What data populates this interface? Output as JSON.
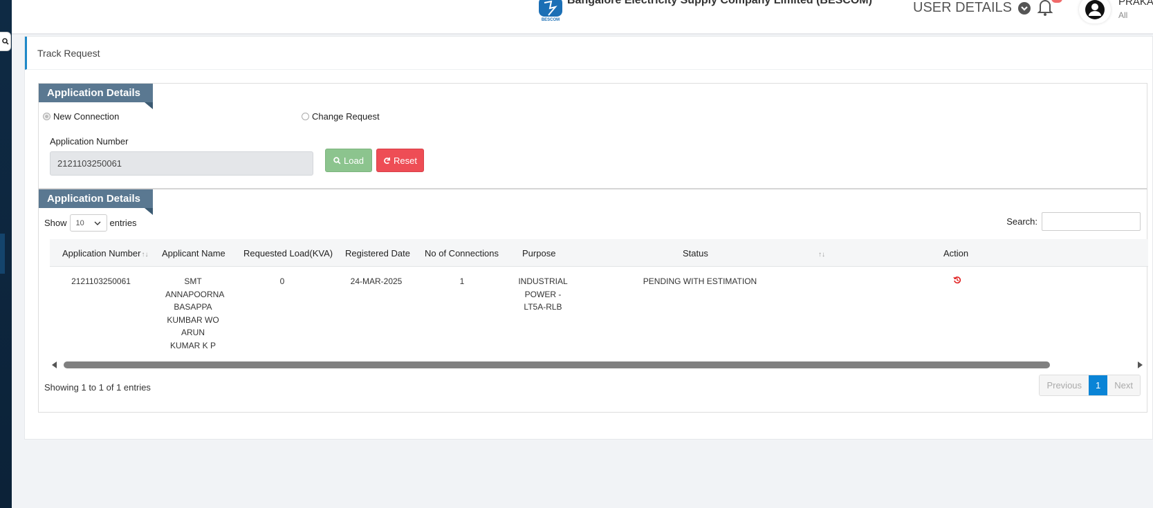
{
  "header": {
    "company_name": "Bangalore Electricity Supply Company Limited (BESCOM)",
    "logo_text": "BESCOM",
    "user_details_label": "USER DETAILS",
    "user_name": "PRAKASH",
    "user_role": "All"
  },
  "page": {
    "title": "Track Request"
  },
  "application_panel": {
    "tab_label": "Application Details",
    "radio_new": "New Connection",
    "radio_change": "Change Request",
    "selected_radio": "New Connection",
    "field_label": "Application Number",
    "field_value": "2121103250061",
    "load_label": "Load",
    "reset_label": "Reset"
  },
  "results_panel": {
    "tab_label": "Application Details",
    "show_label": "Show",
    "entries_label": "entries",
    "page_length": "10",
    "search_label": "Search:",
    "columns": [
      "Application Number",
      "Applicant Name",
      "Requested Load(KVA)",
      "Registered Date",
      "No of Connections",
      "Purpose",
      "Status",
      "Action"
    ],
    "rows": [
      {
        "application_number": "2121103250061",
        "applicant_name": "SMT ANNAPOORNA BASAPPA KUMBAR WO ARUN KUMAR K P",
        "requested_load": "0",
        "registered_date": "24-MAR-2025",
        "no_of_connections": "1",
        "purpose": "INDUSTRIAL POWER - LT5A-RLB",
        "status": "PENDING WITH ESTIMATION",
        "action_icon": "history-icon"
      }
    ],
    "info_text": "Showing 1 to 1 of 1 entries",
    "pagination": {
      "previous": "Previous",
      "current": "1",
      "next": "Next"
    }
  },
  "colors": {
    "tab_bg": "#5a7891",
    "load_btn": "#8cc48e",
    "reset_btn": "#ee4d55",
    "active_page": "#0a84d6",
    "sidebar": "#0e2a44"
  }
}
